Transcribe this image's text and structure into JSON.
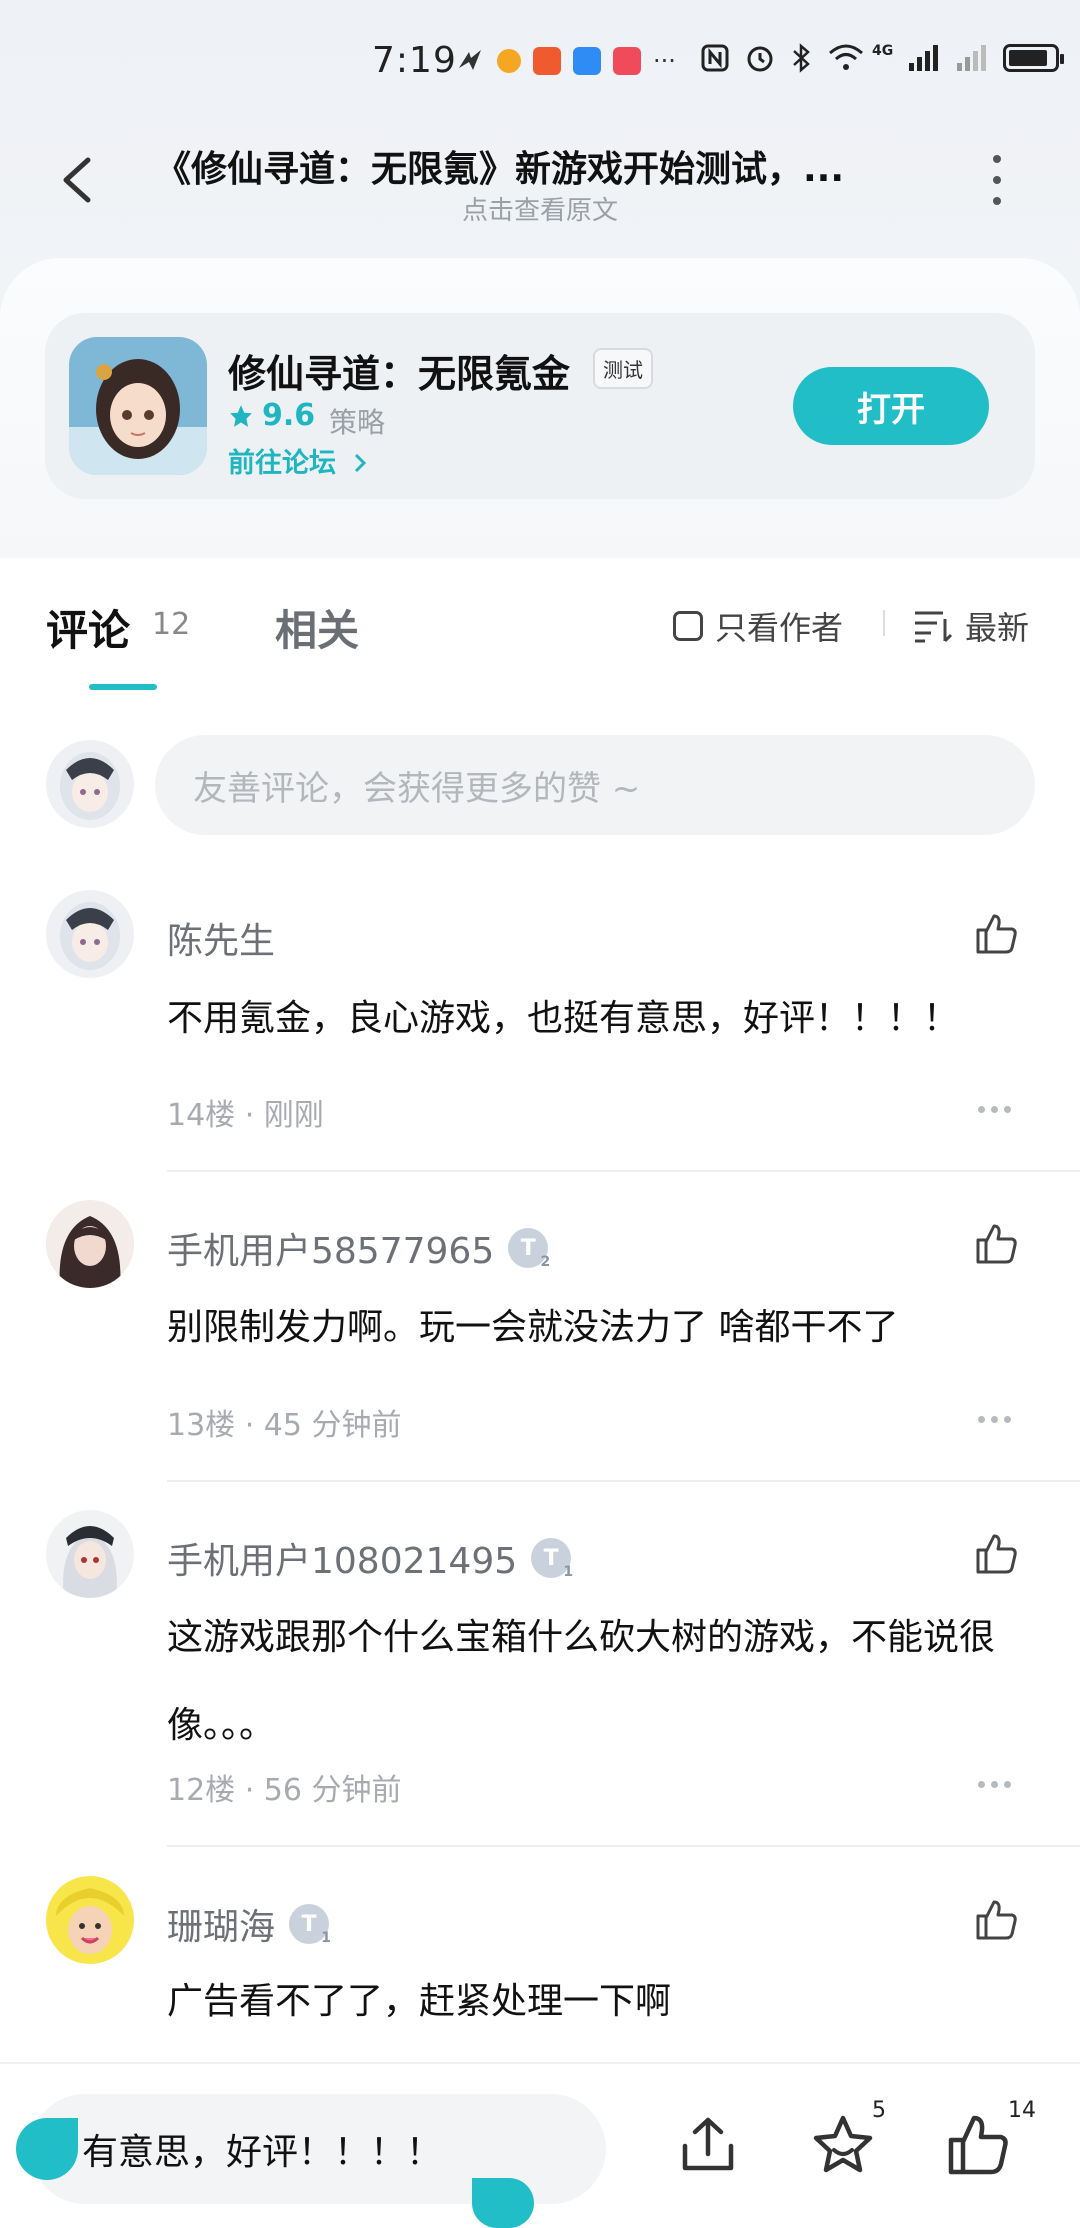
{
  "status_bar": {
    "time": "7:19",
    "network": "4G",
    "sim_label": "6"
  },
  "header": {
    "title": "《修仙寻道：无限氪》新游戏开始测试，...",
    "subtitle": "点击查看原文"
  },
  "game_card": {
    "name": "修仙寻道：无限氪金",
    "badge": "测试",
    "rating": "9.6",
    "category": "策略",
    "forum_link": "前往论坛",
    "open_button": "打开"
  },
  "tabs": {
    "comments_label": "评论",
    "comments_count": "12",
    "related_label": "相关",
    "only_author": "只看作者",
    "sort": "最新"
  },
  "comment_input": {
    "placeholder": "友善评论，会获得更多的赞 ~"
  },
  "comments": [
    {
      "name": "陈先生",
      "level": "",
      "text": "不用氪金，良心游戏，也挺有意思，好评！！！！",
      "meta": "14楼 · 刚刚"
    },
    {
      "name": "手机用户58577965",
      "level": "2",
      "text": "别限制发力啊。玩一会就没法力了 啥都干不了",
      "meta": "13楼 · 45 分钟前"
    },
    {
      "name": "手机用户108021495",
      "level": "1",
      "text": "这游戏跟那个什么宝箱什么砍大树的游戏，不能说很像。。。",
      "meta": "12楼 · 56 分钟前"
    },
    {
      "name": "珊瑚海",
      "level": "1",
      "text": "广告看不了了，赶紧处理一下啊",
      "meta": ""
    }
  ],
  "bottom_bar": {
    "reply_text": "有意思，好评！！！！",
    "star_count": "5",
    "like_count": "14"
  },
  "colors": {
    "accent": "#22bec8",
    "text_primary": "#111111",
    "text_secondary": "#6d7177"
  }
}
